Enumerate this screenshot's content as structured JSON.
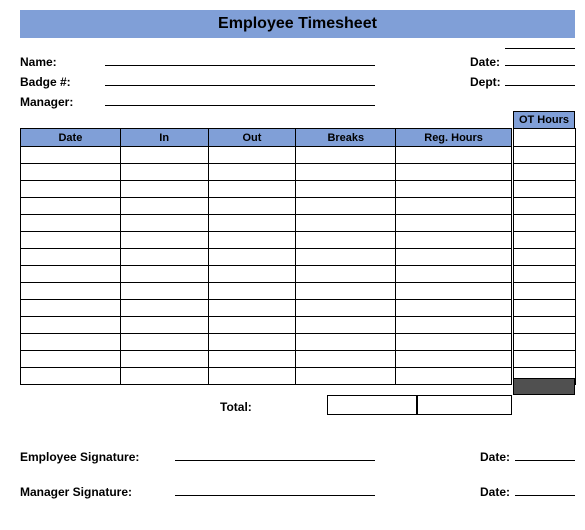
{
  "title": "Employee Timesheet",
  "fields": {
    "name_label": "Name:",
    "badge_label": "Badge #:",
    "manager_label": "Manager:",
    "date_label": "Date:",
    "dept_label": "Dept:",
    "name_value": "",
    "badge_value": "",
    "manager_value": "",
    "date_value": "",
    "dept_value": ""
  },
  "columns": {
    "date": "Date",
    "in": "In",
    "out": "Out",
    "breaks": "Breaks",
    "reg_hours": "Reg. Hours",
    "ot_hours": "OT Hours"
  },
  "rows": [
    {
      "date": "",
      "in": "",
      "out": "",
      "breaks": "",
      "reg_hours": "",
      "ot_hours": ""
    },
    {
      "date": "",
      "in": "",
      "out": "",
      "breaks": "",
      "reg_hours": "",
      "ot_hours": ""
    },
    {
      "date": "",
      "in": "",
      "out": "",
      "breaks": "",
      "reg_hours": "",
      "ot_hours": ""
    },
    {
      "date": "",
      "in": "",
      "out": "",
      "breaks": "",
      "reg_hours": "",
      "ot_hours": ""
    },
    {
      "date": "",
      "in": "",
      "out": "",
      "breaks": "",
      "reg_hours": "",
      "ot_hours": ""
    },
    {
      "date": "",
      "in": "",
      "out": "",
      "breaks": "",
      "reg_hours": "",
      "ot_hours": ""
    },
    {
      "date": "",
      "in": "",
      "out": "",
      "breaks": "",
      "reg_hours": "",
      "ot_hours": ""
    },
    {
      "date": "",
      "in": "",
      "out": "",
      "breaks": "",
      "reg_hours": "",
      "ot_hours": ""
    },
    {
      "date": "",
      "in": "",
      "out": "",
      "breaks": "",
      "reg_hours": "",
      "ot_hours": ""
    },
    {
      "date": "",
      "in": "",
      "out": "",
      "breaks": "",
      "reg_hours": "",
      "ot_hours": ""
    },
    {
      "date": "",
      "in": "",
      "out": "",
      "breaks": "",
      "reg_hours": "",
      "ot_hours": ""
    },
    {
      "date": "",
      "in": "",
      "out": "",
      "breaks": "",
      "reg_hours": "",
      "ot_hours": ""
    },
    {
      "date": "",
      "in": "",
      "out": "",
      "breaks": "",
      "reg_hours": "",
      "ot_hours": ""
    },
    {
      "date": "",
      "in": "",
      "out": "",
      "breaks": "",
      "reg_hours": "",
      "ot_hours": ""
    }
  ],
  "total_label": "Total:",
  "totals": {
    "breaks": "",
    "reg_hours": "",
    "ot_hours": ""
  },
  "signatures": {
    "employee_label": "Employee Signature:",
    "manager_label": "Manager Signature:",
    "date_label": "Date:",
    "employee_value": "",
    "employee_date": "",
    "manager_value": "",
    "manager_date": ""
  }
}
